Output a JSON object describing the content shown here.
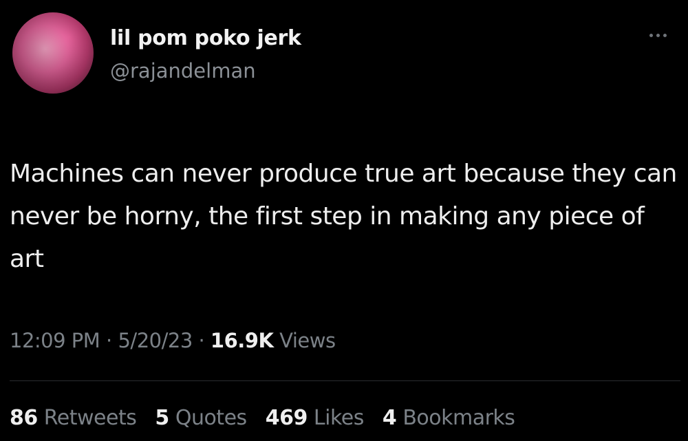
{
  "user": {
    "display_name": "lil pom poko jerk",
    "handle": "@rajandelman",
    "avatar": "avatar-photo"
  },
  "tweet": {
    "text": "Machines can never produce true art because they can never be horny, the first step in making any piece of art"
  },
  "meta": {
    "time": "12:09 PM",
    "separator": "·",
    "date": "5/20/23",
    "views_count": "16.9K",
    "views_label": "Views"
  },
  "stats": {
    "retweets_count": "86",
    "retweets_label": "Retweets",
    "quotes_count": "5",
    "quotes_label": "Quotes",
    "likes_count": "469",
    "likes_label": "Likes",
    "bookmarks_count": "4",
    "bookmarks_label": "Bookmarks"
  },
  "icons": {
    "more": "more-options-icon"
  },
  "colors": {
    "background": "#000000",
    "primary_text": "#e7e9ea",
    "secondary_text": "#7c8288"
  }
}
